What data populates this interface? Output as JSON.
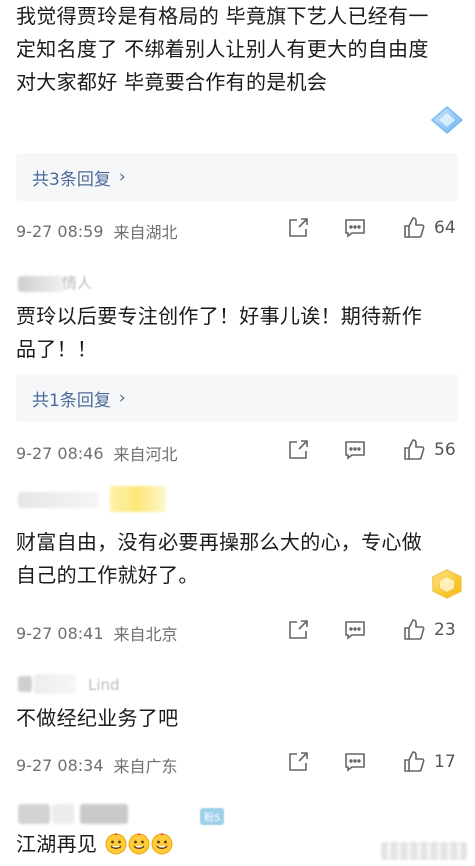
{
  "comments": [
    {
      "text": "我觉得贾玲是有格局的 毕竟旗下艺人已经有一定知名度了 不绑着别人让别人有更大的自由度 对大家都好 毕竟要合作有的是机会",
      "reply_label": "共3条回复",
      "date": "9-27 08:59",
      "location": "来自湖北",
      "likes": "64"
    },
    {
      "username_fragment": "情人",
      "text": "贾玲以后要专注创作了！好事儿诶！期待新作品了！！",
      "reply_label": "共1条回复",
      "date": "9-27 08:46",
      "location": "来自河北",
      "likes": "56"
    },
    {
      "text": "财富自由，没有必要再操那么大的心，专心做自己的工作就好了。",
      "date": "9-27 08:41",
      "location": "来自北京",
      "likes": "23"
    },
    {
      "username_fragment": "Lind",
      "text": "不做经纪业务了吧",
      "date": "9-27 08:34",
      "location": "来自广东",
      "likes": "17"
    },
    {
      "badge": "粉5",
      "text": "江湖再见",
      "emoji": "grinning-face-emoji"
    }
  ],
  "colors": {
    "reply_link": "#4b6b98",
    "reply_bg": "#f6f7f9",
    "meta_text": "#6f6f6f"
  },
  "icons": {
    "share": "share-icon",
    "comment": "comment-icon",
    "like": "thumbs-up-icon"
  }
}
